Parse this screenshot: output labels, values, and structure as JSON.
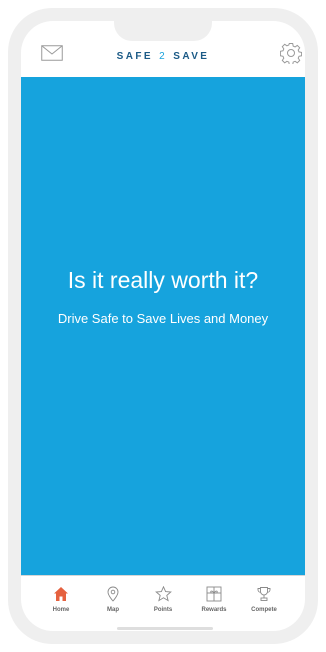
{
  "header": {
    "brand_part1": "SAFE",
    "brand_part2": "2",
    "brand_part3": "SAVE"
  },
  "hero": {
    "title": "Is it really worth it?",
    "subtitle": "Drive Safe to Save Lives and Money"
  },
  "tabs": [
    {
      "label": "Home",
      "icon": "home-icon",
      "active": true
    },
    {
      "label": "Map",
      "icon": "map-pin-icon",
      "active": false
    },
    {
      "label": "Points",
      "icon": "star-icon",
      "active": false
    },
    {
      "label": "Rewards",
      "icon": "gift-icon",
      "active": false
    },
    {
      "label": "Compete",
      "icon": "trophy-icon",
      "active": false
    }
  ],
  "colors": {
    "hero_bg": "#16a3dd",
    "brand": "#1b5a86",
    "active_tab": "#e5613f"
  }
}
